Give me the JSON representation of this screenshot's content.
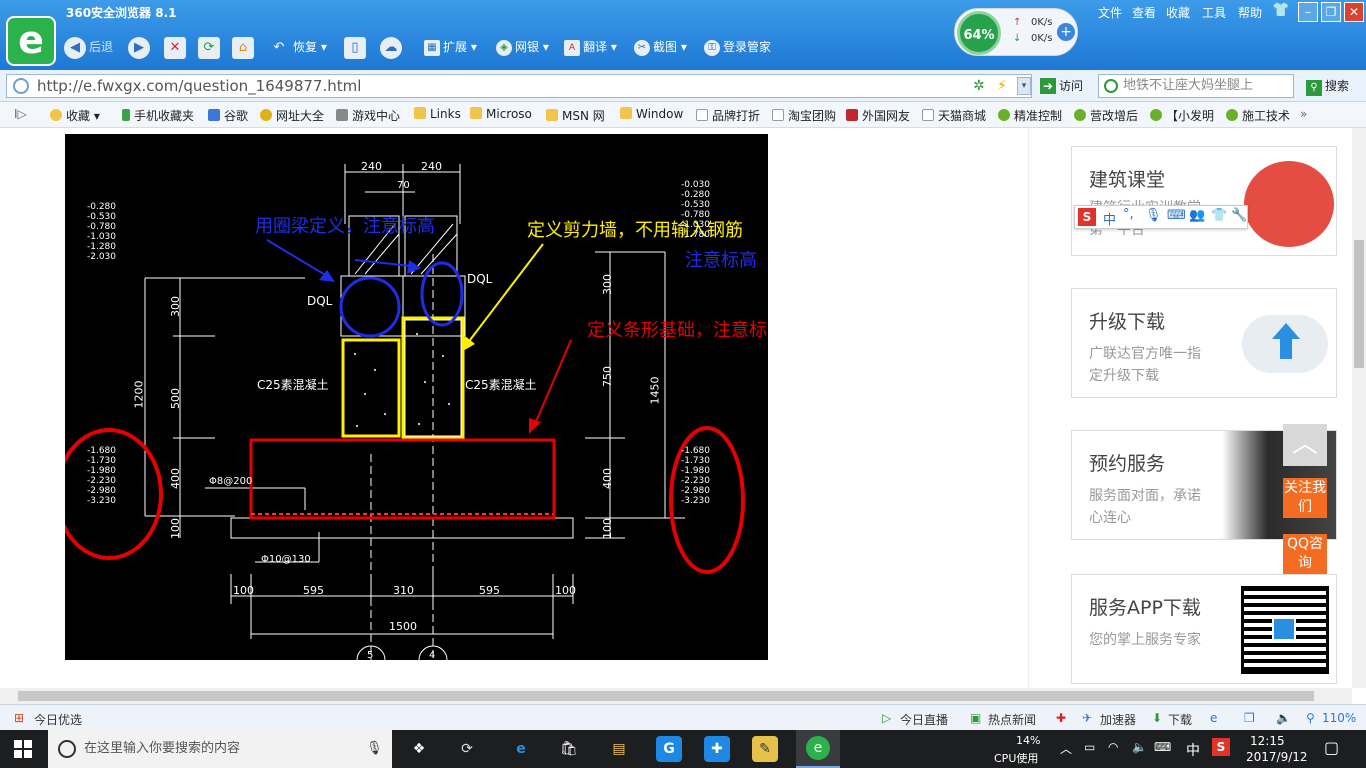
{
  "browser": {
    "title": "360安全浏览器 8.1",
    "menu": [
      "文件",
      "查看",
      "收藏",
      "工具",
      "帮助"
    ],
    "toolbar": {
      "back": "后退",
      "restore": "恢复",
      "extend": "扩展",
      "bank": "网银",
      "translate": "翻译",
      "screenshot": "截图",
      "login_manager": "登录管家"
    },
    "speed": {
      "percent": "64%",
      "up": "0K/s",
      "down": "0K/s"
    },
    "url": "http://e.fwxgx.com/question_1649877.html",
    "visit": "访问",
    "search_placeholder": "地铁不让座大妈坐腿上",
    "search_button": "搜索",
    "bookmarks": [
      "收藏",
      "手机收藏夹",
      "谷歌",
      "网址大全",
      "游戏中心",
      "Links",
      "Microso",
      "MSN 网",
      "Window",
      "品牌打折",
      "淘宝团购",
      "外国网友",
      "天猫商城",
      "精准控制",
      "营改增后",
      "【小发明",
      "施工技术"
    ]
  },
  "drawing": {
    "annotations": {
      "ring_beam": "用圈梁定义，注意标高",
      "shear_wall": "定义剪力墙，不用输入钢筋",
      "shear_wall_note": "注意标高",
      "strip_foundation": "定义条形基础，注意标高"
    },
    "labels": {
      "dql_left": "DQL",
      "dql_right": "DQL",
      "concrete_left": "C25素混凝土",
      "concrete_right": "C25素混凝土",
      "rebar_top": "Φ8@200",
      "rebar_bottom": "Φ10@130"
    },
    "dims_top": [
      "240",
      "240",
      "70"
    ],
    "dims_left": [
      "300",
      "500",
      "1200",
      "400",
      "100"
    ],
    "dims_right": [
      "300",
      "750",
      "1450",
      "400",
      "100"
    ],
    "dims_bottom": [
      "100",
      "595",
      "310",
      "595",
      "100"
    ],
    "dim_total": "1500",
    "elev_left_top": [
      "-0.280",
      "-0.530",
      "-0.780",
      "-1.030",
      "-1.280",
      "-2.030"
    ],
    "elev_left_bottom": [
      "-1.680",
      "-1.730",
      "-1.980",
      "-2.230",
      "-2.980",
      "-3.230"
    ],
    "elev_right_top": [
      "-0.030",
      "-0.280",
      "-0.530",
      "-0.780",
      "-1.030",
      "-1.780"
    ],
    "elev_right_bottom": [
      "-1.680",
      "-1.730",
      "-1.980",
      "-2.230",
      "-2.980",
      "-3.230"
    ],
    "axis_labels": [
      "5",
      "4"
    ]
  },
  "sidebar": {
    "cards": [
      {
        "title": "建筑课堂",
        "sub": "建筑行业实训教学第一平台"
      },
      {
        "title": "升级下载",
        "sub": "广联达官方唯一指定升级下载"
      },
      {
        "title": "预约服务",
        "sub": "服务面对面，承诺心连心"
      },
      {
        "title": "服务APP下载",
        "sub": "您的掌上服务专家"
      }
    ],
    "follow": "关注我们",
    "qq": "QQ咨询",
    "ime": "中"
  },
  "statusbar": {
    "left": "今日优选",
    "live": "今日直播",
    "news": "热点新闻",
    "accelerator": "加速器",
    "download": "下载",
    "zoom": "110%"
  },
  "taskbar": {
    "search": "在这里输入你要搜索的内容",
    "cpu_percent": "14%",
    "cpu_label": "CPU使用",
    "ime": "中",
    "time": "12:15",
    "date": "2017/9/12"
  }
}
